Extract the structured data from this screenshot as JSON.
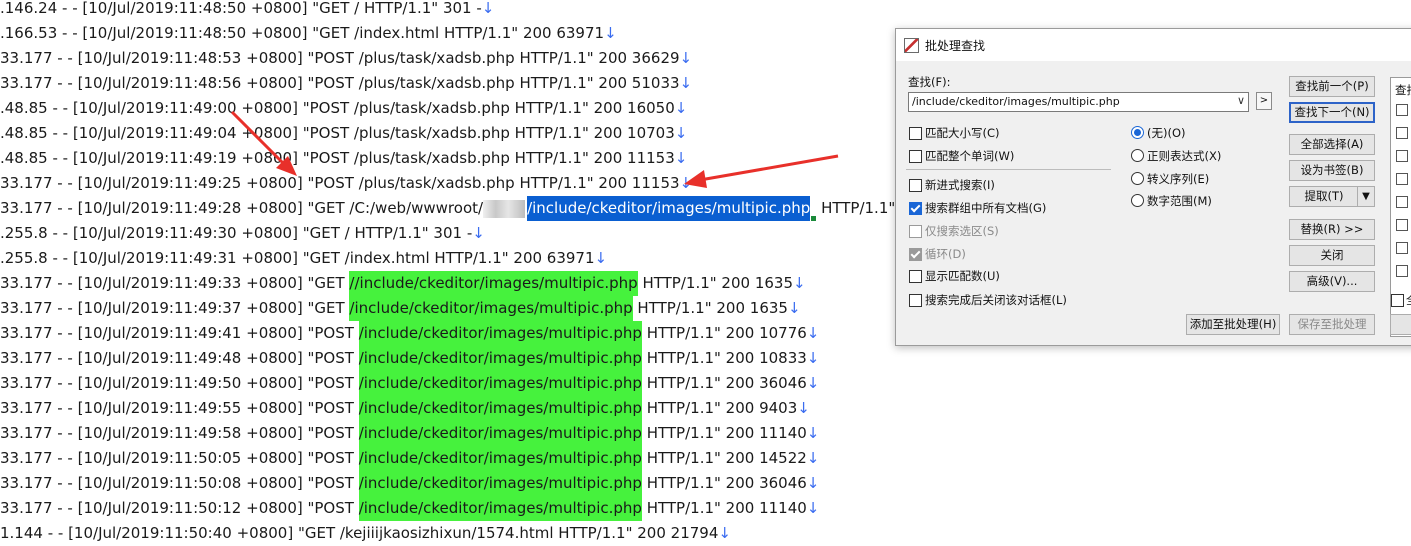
{
  "log_lines": [
    {
      "segments": [
        {
          "t": ".146.24 - - [10/Jul/2019:11:48:50 +0800] \"GET / HTTP/1.1\" 301 -"
        }
      ]
    },
    {
      "segments": [
        {
          "t": ".166.53 - - [10/Jul/2019:11:48:50 +0800] \"GET /index.html HTTP/1.1\" 200 63971"
        }
      ]
    },
    {
      "segments": [
        {
          "t": "33.177 - - [10/Jul/2019:11:48:53 +0800] \"POST /plus/task/xadsb.php HTTP/1.1\" 200 36629"
        }
      ]
    },
    {
      "segments": [
        {
          "t": "33.177 - - [10/Jul/2019:11:48:56 +0800] \"POST /plus/task/xadsb.php HTTP/1.1\" 200 51033"
        }
      ]
    },
    {
      "segments": [
        {
          "t": ".48.85 - - [10/Jul/2019:11:49:00 +0800] \"POST /plus/task/xadsb.php HTTP/1.1\" 200 16050"
        }
      ]
    },
    {
      "segments": [
        {
          "t": ".48.85 - - [10/Jul/2019:11:49:04 +0800] \"POST /plus/task/xadsb.php HTTP/1.1\" 200 10703"
        }
      ]
    },
    {
      "segments": [
        {
          "t": ".48.85 - - [10/Jul/2019:11:49:19 +0800] \"POST /plus/task/xadsb.php HTTP/1.1\" 200 11153"
        }
      ]
    },
    {
      "segments": [
        {
          "t": "33.177 - - [10/Jul/2019:11:49:25 +0800] \"POST /plus/task/xadsb.php HTTP/1.1\" 200 11153"
        }
      ]
    },
    {
      "segments": [
        {
          "t": "33.177 - - [10/Jul/2019:11:49:28 +0800] \"GET /C:/web/wwwroot/"
        },
        {
          "blur": true
        },
        {
          "t": "/include/ckeditor/images/multipic.php",
          "hl": "blue"
        },
        {
          "t": " HTTP/1.1\""
        }
      ],
      "eol": false
    },
    {
      "segments": [
        {
          "t": ".255.8 - - [10/Jul/2019:11:49:30 +0800] \"GET / HTTP/1.1\" 301 -"
        }
      ]
    },
    {
      "segments": [
        {
          "t": ".255.8 - - [10/Jul/2019:11:49:31 +0800] \"GET /index.html HTTP/1.1\" 200 63971"
        }
      ]
    },
    {
      "segments": [
        {
          "t": "33.177 - - [10/Jul/2019:11:49:33 +0800] \"GET "
        },
        {
          "t": "//include/ckeditor/images/multipic.php",
          "hl": "green"
        },
        {
          "t": " HTTP/1.1\" 200 1635"
        }
      ]
    },
    {
      "segments": [
        {
          "t": "33.177 - - [10/Jul/2019:11:49:37 +0800] \"GET "
        },
        {
          "t": "/include/ckeditor/images/multipic.php",
          "hl": "green"
        },
        {
          "t": " HTTP/1.1\" 200 1635"
        }
      ]
    },
    {
      "segments": [
        {
          "t": "33.177 - - [10/Jul/2019:11:49:41 +0800] \"POST "
        },
        {
          "t": "/include/ckeditor/images/multipic.php",
          "hl": "green"
        },
        {
          "t": " HTTP/1.1\" 200 10776"
        }
      ]
    },
    {
      "segments": [
        {
          "t": "33.177 - - [10/Jul/2019:11:49:48 +0800] \"POST "
        },
        {
          "t": "/include/ckeditor/images/multipic.php",
          "hl": "green"
        },
        {
          "t": " HTTP/1.1\" 200 10833"
        }
      ]
    },
    {
      "segments": [
        {
          "t": "33.177 - - [10/Jul/2019:11:49:50 +0800] \"POST "
        },
        {
          "t": "/include/ckeditor/images/multipic.php",
          "hl": "green"
        },
        {
          "t": " HTTP/1.1\" 200 36046"
        }
      ]
    },
    {
      "segments": [
        {
          "t": "33.177 - - [10/Jul/2019:11:49:55 +0800] \"POST "
        },
        {
          "t": "/include/ckeditor/images/multipic.php",
          "hl": "green"
        },
        {
          "t": " HTTP/1.1\" 200 9403"
        }
      ]
    },
    {
      "segments": [
        {
          "t": "33.177 - - [10/Jul/2019:11:49:58 +0800] \"POST "
        },
        {
          "t": "/include/ckeditor/images/multipic.php",
          "hl": "green"
        },
        {
          "t": " HTTP/1.1\" 200 11140"
        }
      ]
    },
    {
      "segments": [
        {
          "t": "33.177 - - [10/Jul/2019:11:50:05 +0800] \"POST "
        },
        {
          "t": "/include/ckeditor/images/multipic.php",
          "hl": "green"
        },
        {
          "t": " HTTP/1.1\" 200 14522"
        }
      ]
    },
    {
      "segments": [
        {
          "t": "33.177 - - [10/Jul/2019:11:50:08 +0800] \"POST "
        },
        {
          "t": "/include/ckeditor/images/multipic.php",
          "hl": "green"
        },
        {
          "t": " HTTP/1.1\" 200 36046"
        }
      ]
    },
    {
      "segments": [
        {
          "t": "33.177 - - [10/Jul/2019:11:50:12 +0800] \"POST "
        },
        {
          "t": "/include/ckeditor/images/multipic.php",
          "hl": "green"
        },
        {
          "t": " HTTP/1.1\" 200 11140"
        }
      ]
    },
    {
      "segments": [
        {
          "t": "1.144 - - [10/Jul/2019:11:50:40 +0800] \"GET /kejiiijkaosizhixun/1574.html HTTP/1.1\" 200 21794"
        }
      ]
    }
  ],
  "eol_marker": "↓",
  "colors": {
    "highlight_green": "#46f23d",
    "selection_blue": "#0a5fd1",
    "arrow_red": "#e8302a"
  },
  "dialog": {
    "title": "批处理查找",
    "find_label": "查找(F):",
    "find_value": "/include/ckeditor/images/multipic.php",
    "combo_arrow": "∨",
    "side_button": ">",
    "options": {
      "match_case": "匹配大小写(C)",
      "whole_word": "匹配整个单词(W)",
      "incremental": "新进式搜索(I)",
      "all_docs": "搜索群组中所有文档(G)",
      "selection_only": "仅搜索选区(S)",
      "wrap": "循环(D)",
      "show_count": "显示匹配数(U)",
      "close_after": "搜索完成后关闭该对话框(L)"
    },
    "modes": {
      "none": "(无)(O)",
      "regex": "正则表达式(X)",
      "escape": "转义序列(E)",
      "numeric": "数字范围(M)"
    },
    "buttons": {
      "find_prev": "查找前一个(P)",
      "find_next": "查找下一个(N)",
      "select_all": "全部选择(A)",
      "bookmark": "设为书签(B)",
      "extract": "提取(T)",
      "replace": "替换(R) >>",
      "close": "关闭",
      "advanced": "高级(V)...",
      "add_batch": "添加至批处理(H)",
      "save_batch": "保存至批处理"
    },
    "side_panel_header": "查找",
    "side_panel_footer": "全"
  }
}
